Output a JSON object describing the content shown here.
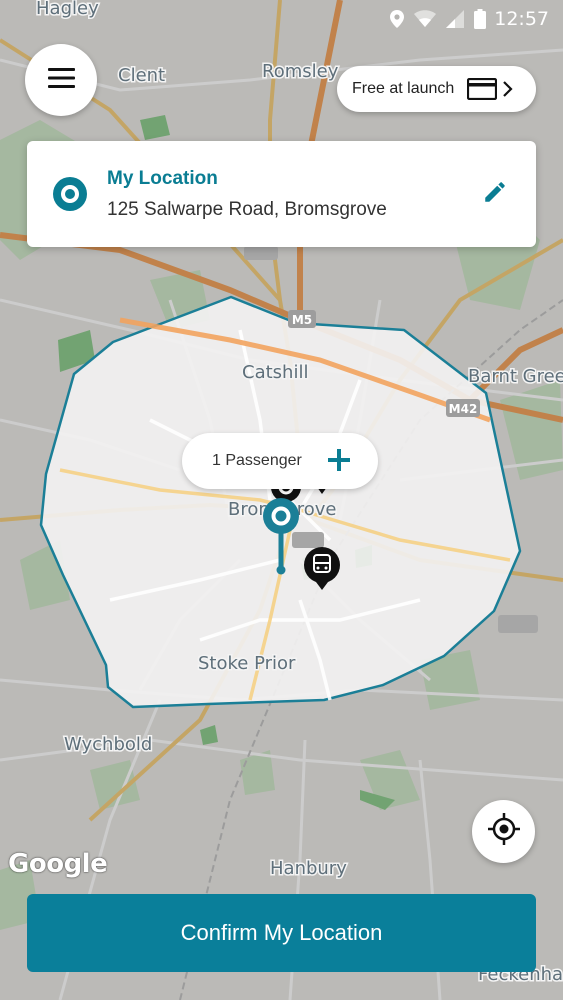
{
  "status_bar": {
    "time": "12:57"
  },
  "map": {
    "places": [
      {
        "name": "Hagley"
      },
      {
        "name": "Clent"
      },
      {
        "name": "Romsley"
      },
      {
        "name": "Catshill"
      },
      {
        "name": "Barnt Green"
      },
      {
        "name": "Bromsgrove"
      },
      {
        "name": "Stoke Prior"
      },
      {
        "name": "Wychbold"
      },
      {
        "name": "Hanbury"
      },
      {
        "name": "Feckenham"
      }
    ],
    "road_shields": {
      "m5": "M5",
      "m42": "M42"
    },
    "attribution": "Google",
    "zone_color": "#1b7f97"
  },
  "header": {
    "menu_icon": "hamburger-menu-icon",
    "free_label": "Free at launch",
    "card_icon": "payment-card-icon",
    "chevron_icon": "chevron-right-icon"
  },
  "location_card": {
    "title": "My Location",
    "address": "125 Salwarpe Road, Bromsgrove",
    "pin_icon": "location-target-icon",
    "edit_icon": "pencil-edit-icon"
  },
  "passenger": {
    "label": "1 Passenger",
    "add_icon": "plus-icon"
  },
  "gps_icon": "crosshair-gps-icon",
  "confirm_label": "Confirm My Location",
  "colors": {
    "accent": "#0a7f9a",
    "title": "#0a7d93"
  }
}
